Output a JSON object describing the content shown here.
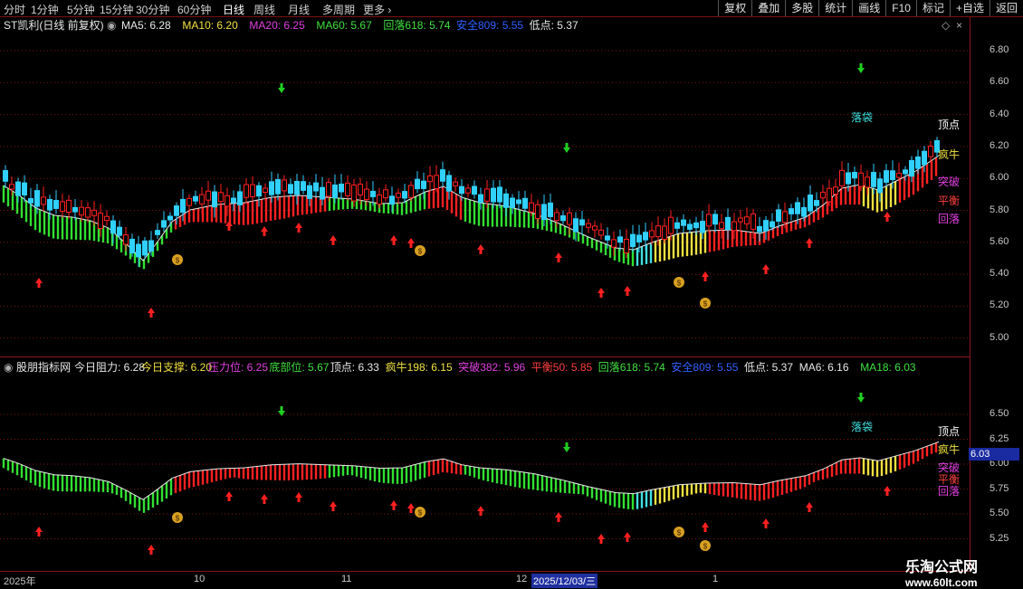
{
  "toolbar": {
    "periods": [
      "分时",
      "1分钟",
      "5分钟",
      "15分钟",
      "30分钟",
      "60分钟",
      "日线",
      "周线",
      "月线",
      "多周期",
      "更多"
    ],
    "active_period": "日线",
    "actions": [
      "复权",
      "叠加",
      "多股",
      "统计",
      "画线",
      "F10",
      "标记",
      "+自选",
      "返回"
    ]
  },
  "main_panel": {
    "title": "ST凯利(日线 前复权)",
    "indicators": [
      {
        "label": "MA5: 6.28",
        "color": "#e8e8e8"
      },
      {
        "label": "MA10: 6.20",
        "color": "#f0e040"
      },
      {
        "label": "MA20: 6.25",
        "color": "#e040e0"
      },
      {
        "label": "MA60: 5.67",
        "color": "#40e040"
      },
      {
        "label": "回落618: 5.74",
        "color": "#40e040"
      },
      {
        "label": "安全809: 5.55",
        "color": "#3060ff"
      },
      {
        "label": "低点: 5.37",
        "color": "#e8e8e8"
      }
    ],
    "y_ticks": [
      "6.80",
      "6.60",
      "6.40",
      "6.20",
      "6.00",
      "5.80",
      "5.60",
      "5.40",
      "5.20",
      "5.00"
    ],
    "labels": [
      {
        "text": "顶点",
        "color": "#ffffff"
      },
      {
        "text": "疯牛",
        "color": "#f0e040"
      },
      {
        "text": "突破",
        "color": "#e040e0"
      },
      {
        "text": "平衡",
        "color": "#ff4040"
      },
      {
        "text": "回落",
        "color": "#e040e0"
      },
      {
        "text": "落袋",
        "color": "#40e0e0"
      }
    ]
  },
  "sub_panel": {
    "title": "股朋指标网",
    "indicators": [
      {
        "label": "今日阻力: 6.28",
        "color": "#e8e8e8"
      },
      {
        "label": "今日支撑: 6.20",
        "color": "#f0e040"
      },
      {
        "label": "压力位: 6.25",
        "color": "#e040e0"
      },
      {
        "label": "底部位: 5.67",
        "color": "#40e040"
      },
      {
        "label": "顶点: 6.33",
        "color": "#e8e8e8"
      },
      {
        "label": "疯牛198: 6.15",
        "color": "#f0e040"
      },
      {
        "label": "突破382: 5.96",
        "color": "#e040e0"
      },
      {
        "label": "平衡50: 5.85",
        "color": "#ff4040"
      },
      {
        "label": "回落618: 5.74",
        "color": "#40e040"
      },
      {
        "label": "安全809: 5.55",
        "color": "#3060ff"
      },
      {
        "label": "低点: 5.37",
        "color": "#e8e8e8"
      },
      {
        "label": "MA6: 6.16",
        "color": "#e8e8e8"
      },
      {
        "label": "MA18: 6.03",
        "color": "#40e040"
      }
    ],
    "y_ticks": [
      "6.50",
      "6.25",
      "6.00",
      "5.75",
      "5.50",
      "5.25"
    ],
    "current_price": "6.03",
    "labels": [
      {
        "text": "顶点",
        "color": "#ffffff"
      },
      {
        "text": "疯牛",
        "color": "#f0e040"
      },
      {
        "text": "突破",
        "color": "#e040e0"
      },
      {
        "text": "平衡",
        "color": "#ff4040"
      },
      {
        "text": "回落",
        "color": "#e040e0"
      },
      {
        "text": "落袋",
        "color": "#40e0e0"
      }
    ]
  },
  "x_axis": {
    "labels": [
      "2025年",
      "10",
      "11",
      "12",
      "2025/12/03/三",
      "1"
    ]
  },
  "watermark": {
    "line1": "乐淘公式网",
    "line2": "www.60lt.com"
  },
  "colors": {
    "up": "#ff2020",
    "down": "#20e0e0",
    "green_band": "#30e030",
    "red_band": "#ff2020",
    "yellow_band": "#f0e040",
    "cyan_band": "#40e0e0"
  }
}
